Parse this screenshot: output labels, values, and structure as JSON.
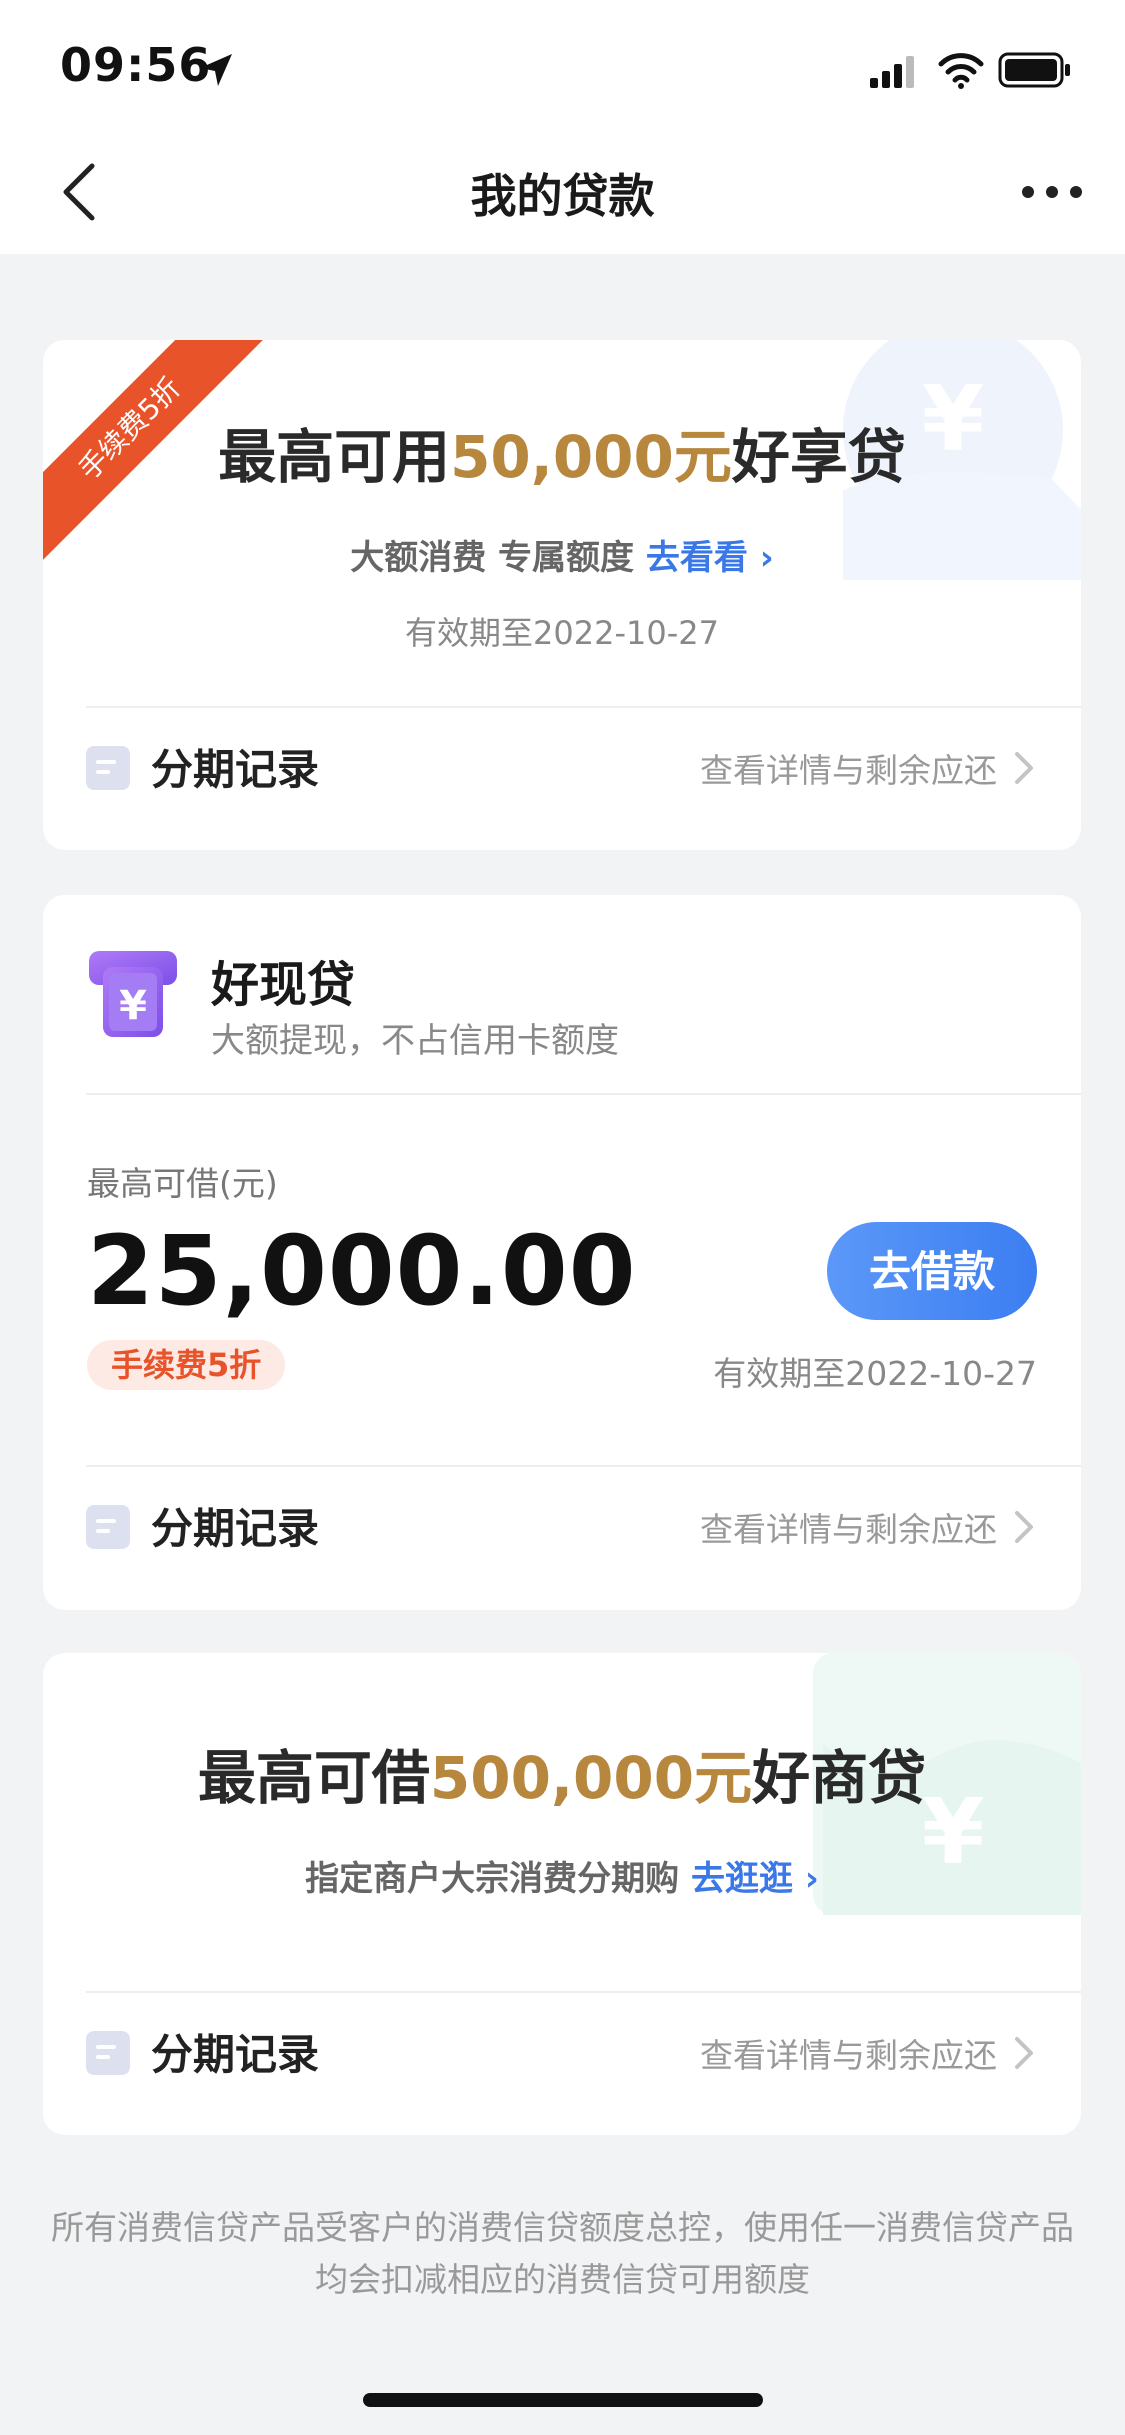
{
  "status_bar": {
    "time": "09:56"
  },
  "nav": {
    "title": "我的贷款"
  },
  "colors": {
    "accent_blue": "#3b78e7",
    "gold": "#b8873e",
    "ribbon_red": "#e8532a",
    "purple_icon": "#8a5cf0"
  },
  "card1": {
    "ribbon": "手续费5折",
    "title_prefix": "最高可用",
    "title_amount": "50,000元",
    "title_suffix": "好享贷",
    "subtitle": "大额消费 专属额度",
    "link": "去看看",
    "valid": "有效期至2022-10-27",
    "record_label": "分期记录",
    "record_link": "查看详情与剩余应还"
  },
  "card2": {
    "product_name": "好现贷",
    "product_desc": "大额提现，不占信用卡额度",
    "limit_label": "最高可借(元)",
    "limit_amount": "25,000.00",
    "borrow_button": "去借款",
    "fee_badge": "手续费5折",
    "valid": "有效期至2022-10-27",
    "record_label": "分期记录",
    "record_link": "查看详情与剩余应还"
  },
  "card3": {
    "title_prefix": "最高可借",
    "title_amount": "500,000元",
    "title_suffix": "好商贷",
    "subtitle": "指定商户大宗消费分期购",
    "link": "去逛逛",
    "record_label": "分期记录",
    "record_link": "查看详情与剩余应还"
  },
  "footer_note": "所有消费信贷产品受客户的消费信贷额度总控，使用任一消费信贷产品均会扣减相应的消费信贷可用额度"
}
